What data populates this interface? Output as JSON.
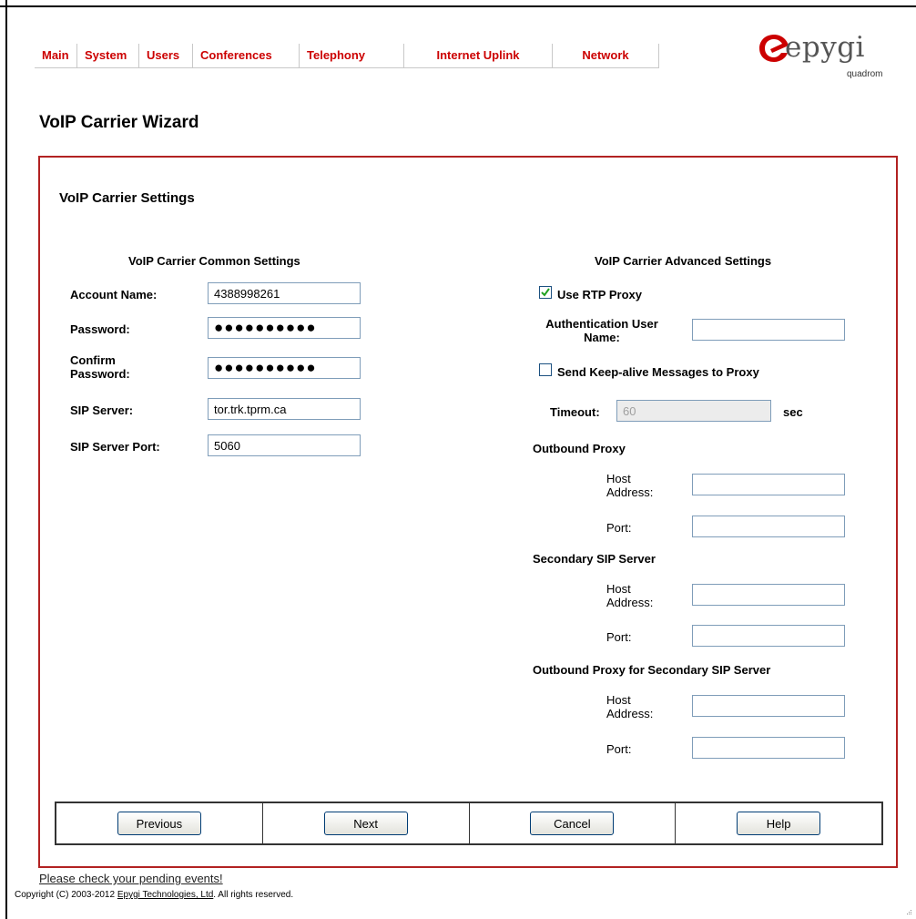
{
  "nav": {
    "items": [
      "Main",
      "System",
      "Users",
      "Conferences",
      "Telephony",
      "Internet Uplink",
      "Network"
    ]
  },
  "logo": {
    "word": "epygi",
    "sub": "quadrom"
  },
  "page_title": "VoIP Carrier Wizard",
  "panel": {
    "title": "VoIP Carrier Settings",
    "common": {
      "title": "VoIP Carrier Common Settings",
      "account_name": {
        "label": "Account Name:",
        "value": "4388998261"
      },
      "password": {
        "label": "Password:",
        "value": "●●●●●●●●●●"
      },
      "confirm_password": {
        "label": "Confirm Password:",
        "value": "●●●●●●●●●●"
      },
      "sip_server": {
        "label": "SIP Server:",
        "value": "tor.trk.tprm.ca"
      },
      "sip_server_port": {
        "label": "SIP Server Port:",
        "value": "5060"
      }
    },
    "advanced": {
      "title": "VoIP Carrier Advanced Settings",
      "use_rtp_proxy": {
        "label": "Use RTP Proxy",
        "checked": true
      },
      "auth_user_name": {
        "label": "Authentication User Name:",
        "value": ""
      },
      "keep_alive": {
        "label": "Send Keep-alive Messages to Proxy",
        "checked": false
      },
      "timeout": {
        "label": "Timeout:",
        "value": "60",
        "unit": "sec"
      },
      "outbound_proxy": {
        "title": "Outbound Proxy",
        "host_label": "Host Address:",
        "port_label": "Port:",
        "host": "",
        "port": ""
      },
      "secondary_sip": {
        "title": "Secondary SIP Server",
        "host_label": "Host Address:",
        "port_label": "Port:",
        "host": "",
        "port": ""
      },
      "outbound_proxy_secondary": {
        "title": "Outbound Proxy for Secondary SIP Server",
        "host_label": "Host Address:",
        "port_label": "Port:",
        "host": "",
        "port": ""
      }
    },
    "buttons": {
      "previous": "Previous",
      "next": "Next",
      "cancel": "Cancel",
      "help": "Help"
    }
  },
  "footer": {
    "pending": "Please check your pending events!",
    "copyright_prefix": "Copyright (C) 2003-2012 ",
    "copyright_link": "Epygi Technologies, Ltd",
    "copyright_suffix": ". All rights reserved."
  },
  "colors": {
    "nav_text": "#cc0000",
    "panel_border": "#b22222",
    "logo_red": "#cc0000"
  }
}
